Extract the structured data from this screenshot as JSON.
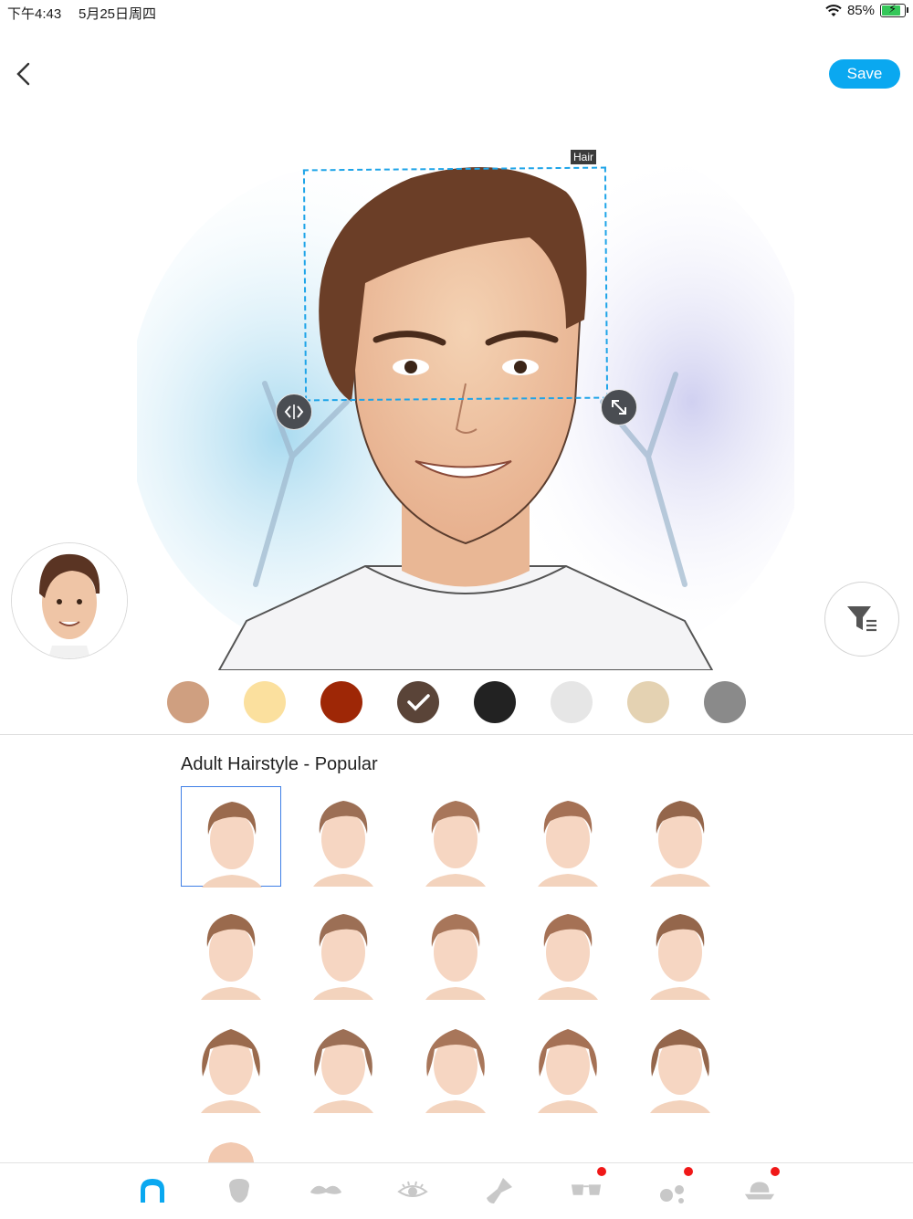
{
  "status_bar": {
    "time": "下午4:43",
    "date": "5月25日周四",
    "battery": "85%"
  },
  "toolbar": {
    "back_icon": "chevron-left-icon",
    "save_label": "Save"
  },
  "editor": {
    "selection_tag": "Hair",
    "colors": {
      "accent": "#0aa8f0",
      "selection": "#1ea4e8"
    }
  },
  "hair_colors": [
    {
      "hex": "#cf9f80",
      "selected": false
    },
    {
      "hex": "#fbe09e",
      "selected": false
    },
    {
      "hex": "#9e2706",
      "selected": false
    },
    {
      "hex": "#5a4438",
      "selected": true
    },
    {
      "hex": "#222222",
      "selected": false
    },
    {
      "hex": "#e6e6e6",
      "selected": false
    },
    {
      "hex": "#e4d2b2",
      "selected": false
    },
    {
      "hex": "#8a8a8a",
      "selected": false
    }
  ],
  "hairstyles": {
    "section_title": "Adult Hairstyle - Popular",
    "selected_index": 0,
    "count_visible": 16
  },
  "tabs": [
    {
      "icon": "hair-icon",
      "active": true,
      "badge": false
    },
    {
      "icon": "face-shape-icon",
      "active": false,
      "badge": false
    },
    {
      "icon": "mustache-icon",
      "active": false,
      "badge": false
    },
    {
      "icon": "eye-icon",
      "active": false,
      "badge": false
    },
    {
      "icon": "makeup-brush-icon",
      "active": false,
      "badge": false
    },
    {
      "icon": "glasses-icon",
      "active": false,
      "badge": true
    },
    {
      "icon": "accessories-icon",
      "active": false,
      "badge": true
    },
    {
      "icon": "hat-icon",
      "active": false,
      "badge": true
    }
  ]
}
